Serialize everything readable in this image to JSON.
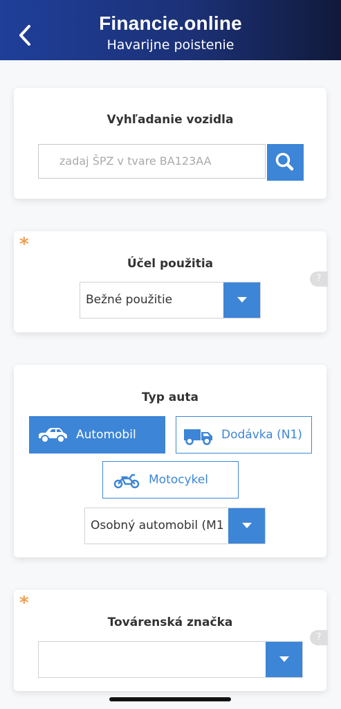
{
  "header": {
    "title": "Financie.online",
    "subtitle": "Havarijne poistenie",
    "back_icon": "chevron-left-icon"
  },
  "vehicle_search": {
    "title": "Vyhľadanie vozidla",
    "placeholder": "zadaj ŠPZ v tvare BA123AA",
    "search_icon": "search-icon"
  },
  "usage": {
    "title": "Účel použitia",
    "required_mark": "*",
    "help_label": "?",
    "selected": "Bežné použitie"
  },
  "car_type": {
    "title": "Typ auta",
    "options": [
      {
        "label": "Automobil",
        "icon": "car-icon",
        "active": true
      },
      {
        "label": "Dodávka (N1)",
        "icon": "van-icon",
        "active": false
      },
      {
        "label": "Motocykel",
        "icon": "motorcycle-icon",
        "active": false
      }
    ],
    "subtype_selected": "Osobný automobil (M1"
  },
  "brand": {
    "title": "Továrenská značka",
    "required_mark": "*",
    "help_label": "?",
    "selected": ""
  },
  "colors": {
    "header_start": "#1f3f9a",
    "header_end": "#111a3c",
    "accent": "#3d85d6",
    "required": "#f0a050"
  }
}
